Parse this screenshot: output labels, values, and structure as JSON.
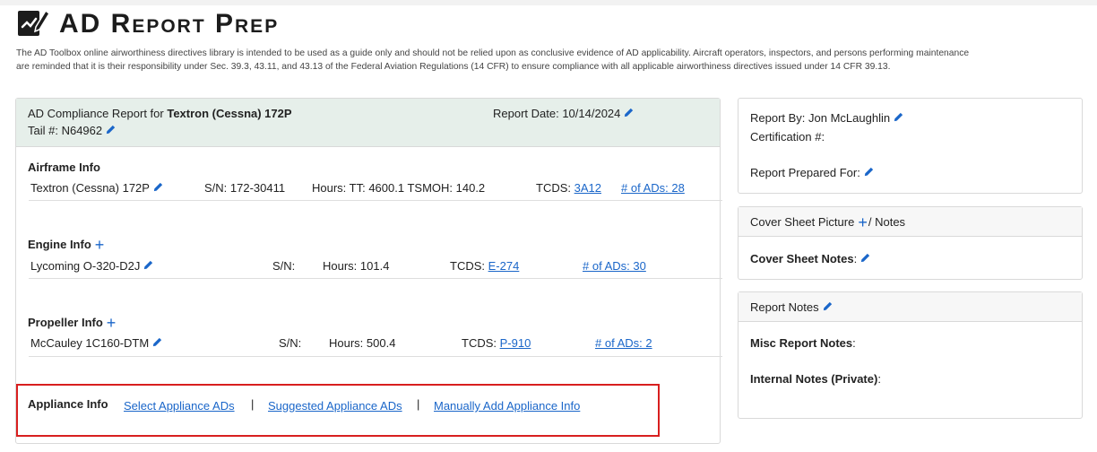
{
  "header": {
    "title": "AD Report Prep",
    "disclaimer_line1": "The AD Toolbox online airworthiness directives library is intended to be used as a guide only and should not be relied upon as conclusive evidence of AD applicability. Aircraft operators, inspectors, and persons performing maintenance",
    "disclaimer_line2": "are reminded that it is their responsibility under Sec. 39.3, 43.11, and 43.13 of the Federal Aviation Regulations (14 CFR) to ensure compliance with all applicable airworthiness directives issued under 14 CFR 39.13."
  },
  "report": {
    "compliance_prefix": "AD Compliance Report for ",
    "aircraft": "Textron (Cessna) 172P",
    "report_date": "Report Date: 10/14/2024",
    "tail": "Tail #: N64962"
  },
  "airframe": {
    "heading": "Airframe Info",
    "model": "Textron (Cessna) 172P",
    "sn": "S/N: 172-30411",
    "hours": "Hours: TT: 4600.1 TSMOH: 140.2",
    "tcds_label": "TCDS: ",
    "tcds_link": "3A12",
    "ads_link": "# of ADs: 28"
  },
  "engine": {
    "heading": "Engine Info",
    "model": "Lycoming O-320-D2J",
    "sn": "S/N:",
    "hours": "Hours: 101.4",
    "tcds_label": "TCDS: ",
    "tcds_link": "E-274",
    "ads_link": "# of ADs: 30"
  },
  "propeller": {
    "heading": "Propeller Info",
    "model": "McCauley 1C160-DTM",
    "sn": "S/N:",
    "hours": "Hours: 500.4",
    "tcds_label": "TCDS: ",
    "tcds_link": "P-910",
    "ads_link": "# of ADs: 2"
  },
  "appliance": {
    "heading": "Appliance Info",
    "select_link": "Select Appliance ADs",
    "suggested_link": "Suggested Appliance ADs",
    "manual_link": "Manually Add Appliance Info",
    "separator": "|"
  },
  "right": {
    "report_by": "Report By: Jon McLaughlin",
    "certification": "Certification #:",
    "prepared_for": "Report Prepared For:",
    "cover_head_a": "Cover Sheet Picture",
    "cover_head_b": "/ Notes",
    "cover_notes": "Cover Sheet Notes",
    "colon": ":",
    "report_notes_head": "Report Notes",
    "misc_notes": "Misc Report Notes",
    "internal_notes": "Internal Notes (Private)"
  },
  "colors": {
    "accent": "#1a66c9",
    "header_bg": "#e6efea",
    "highlight": "#d81f1f"
  }
}
